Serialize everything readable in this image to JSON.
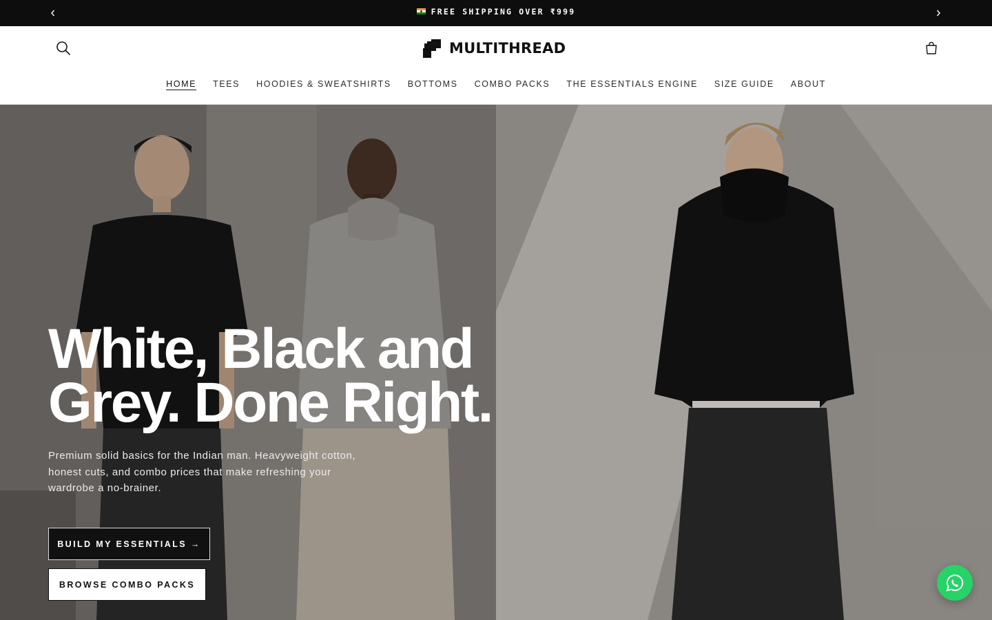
{
  "announcement": {
    "text": "FREE SHIPPING OVER ₹999",
    "flag_icon": "india-flag-icon",
    "prev_icon": "chevron-left-icon",
    "next_icon": "chevron-right-icon"
  },
  "header": {
    "brand": "MULTITHREAD",
    "search_icon": "search-icon",
    "cart_icon": "shopping-bag-icon",
    "nav": [
      {
        "label": "HOME",
        "active": true
      },
      {
        "label": "TEES",
        "active": false
      },
      {
        "label": "HOODIES & SWEATSHIRTS",
        "active": false
      },
      {
        "label": "BOTTOMS",
        "active": false
      },
      {
        "label": "COMBO PACKS",
        "active": false
      },
      {
        "label": "THE ESSENTIALS ENGINE",
        "active": false
      },
      {
        "label": "SIZE GUIDE",
        "active": false
      },
      {
        "label": "ABOUT",
        "active": false
      }
    ]
  },
  "hero": {
    "title_line1": "White, Black and",
    "title_line2": "Grey. Done Right.",
    "subtitle": "Premium solid basics for the Indian man. Heavyweight cotton, honest cuts, and combo prices that make refreshing your wardrobe a no-brainer.",
    "primary_cta": "BUILD MY ESSENTIALS →",
    "secondary_cta": "BROWSE COMBO PACKS"
  },
  "floating": {
    "whatsapp_icon": "whatsapp-icon"
  },
  "colors": {
    "announcement_bg": "#0d0d0d",
    "primary_button_bg": "#111111",
    "whatsapp_green": "#25d366"
  }
}
